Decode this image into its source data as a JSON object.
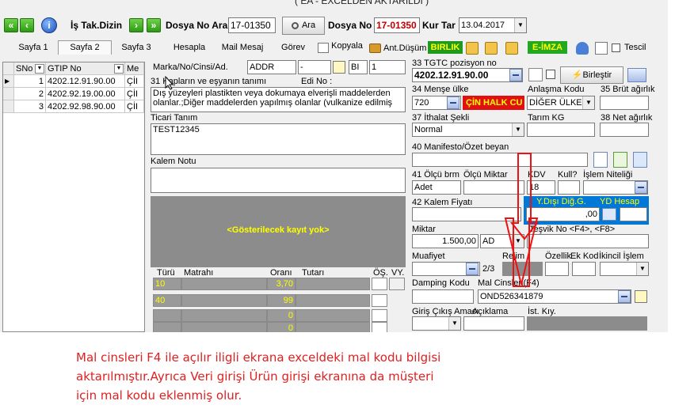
{
  "window": {
    "title": "( EA - EXCELDEN AKTARILDI )"
  },
  "toolbar": {
    "is_takip_label": "İş Tak.Dizin",
    "dosya_no_ara_label": "Dosya No Ara",
    "dosya_no_ara_value": "17-01350",
    "ara_label": "Ara",
    "dosya_no_label": "Dosya No",
    "dosya_no_value": "17-01350",
    "kur_tar_label": "Kur Tar",
    "kur_tar_value": "13.04.2017"
  },
  "tabs": [
    {
      "label": "Sayfa 1"
    },
    {
      "label": "Sayfa 2"
    },
    {
      "label": "Sayfa 3"
    },
    {
      "label": "Hesapla"
    },
    {
      "label": "Mail Mesaj"
    },
    {
      "label": "Görev"
    },
    {
      "label": "Kopyala"
    },
    {
      "label": "Ant.Düşüm"
    }
  ],
  "toolbar2": {
    "birlik": "BIRLIK",
    "eimza": "E-İMZA",
    "tescil": "Tescil"
  },
  "grid": {
    "headers": [
      "SNo",
      "GTIP No",
      "Me"
    ],
    "rows": [
      {
        "sno": "1",
        "gtip": "4202.12.91.90.00",
        "me": "ÇİI"
      },
      {
        "sno": "2",
        "gtip": "4202.92.19.00.00",
        "me": "ÇİI"
      },
      {
        "sno": "3",
        "gtip": "4202.92.98.90.00",
        "me": "ÇİI"
      }
    ]
  },
  "form": {
    "marka_label": "Marka/No/Cinsi/Ad.",
    "marka_value": "ADDR",
    "marka_value2": "-",
    "marka_value3": "BI",
    "marka_value4": "1",
    "esya_label": "31 Kapların ve eşyanın tanımı",
    "edi_no_label": "Edi No :",
    "esya_text": "Dış yüzeyleri plastikten veya dokumaya elverişli maddelerden olanlar.;Diğer maddelerden yapılmış olanlar (vulkanize edilmiş",
    "ticari_label": "Ticari Tanım",
    "ticari_value": "TEST12345",
    "kalem_notu_label": "Kalem Notu",
    "no_record": "<Gösterilecek kayıt yok>",
    "vergi_headers": {
      "turu": "Türü",
      "matrah": "Matrahı",
      "orani": "Oranı",
      "tutar": "Tutarı",
      "os": "ÖŞ.",
      "vy": "VY."
    },
    "vergi_rows": [
      {
        "turu": "10",
        "orani": "3,70"
      },
      {
        "turu": "40",
        "orani": "99"
      },
      {
        "turu": "",
        "orani": "0"
      },
      {
        "turu": "",
        "orani": "0"
      },
      {
        "turu": "",
        "orani": "0"
      }
    ]
  },
  "right": {
    "gtip_label": "33 TGTC pozisyon no",
    "gtip_value": "4202.12.91.90.00",
    "birlestir": "Birleştir",
    "mense_label": "34 Menşe ülke",
    "anlasma_label": "Anlaşma Kodu",
    "brut_label": "35 Brüt ağırlık",
    "mense_code": "720",
    "mense_name": "ÇİN HALK CU",
    "anlasma_value": "DİĞER ÜLKEL",
    "ithalat_label": "37 İthalat Şekli",
    "tarim_label": "Tarım KG",
    "net_label": "38 Net ağırlık",
    "ithalat_value": "Normal",
    "manifesto_label": "40 Manifesto/Özet beyan",
    "olcu_brm_label": "41 Ölçü brm",
    "olcu_miktar_label": "Ölçü Miktar",
    "kdv_label": "KDV",
    "kull_label": "Kull?",
    "islem_label": "İşlem Niteliği",
    "olcu_brm_value": "Adet",
    "kdv_value": "18",
    "kalem_fiyati_label": "42 Kalem Fiyatı",
    "ydisi_label": "Y.Dışı Diğ.G.",
    "yd_hesap_label": "YD Hesap",
    "ydisi_value": ",00",
    "miktar_label": "Miktar",
    "tesvik_label": "Teşvik No <F4>, <F8>",
    "miktar_value": "1.500,00",
    "miktar_unit": "AD",
    "muafiyet_label": "Muafiyet",
    "rejim_label": "Rejim",
    "ozellik_label": "Özellik",
    "ek_kod_label": "Ek Kod",
    "ikincil_label": "İkincil İşlem",
    "muafiyet_page": "2/3",
    "damping_label": "Damping Kodu",
    "mal_cinsleri_label": "Mal Cinsleri(F4)",
    "mal_cinsleri_value": "OND526341879",
    "giris_label": "Giriş Çıkış Amacı",
    "aciklama_label": "Açıklama",
    "ist_kiy_label": "İst. Kıy."
  },
  "annotation": {
    "line1": "Mal cinsleri F4 ile açılır iligli ekrana exceldeki mal kodu bilgisi",
    "line2": "aktarılmıştır.Ayrıca Veri girişi Ürün girişi ekranına da müşteri",
    "line3": "için mal kodu eklenmiş olur."
  },
  "colors": {
    "annotation_red": "#e02020",
    "arrow_red": "#ee1111",
    "yellow_text": "#ffff00",
    "gray_panel": "#8c8c8c",
    "selection_blue": "#0078d7"
  }
}
